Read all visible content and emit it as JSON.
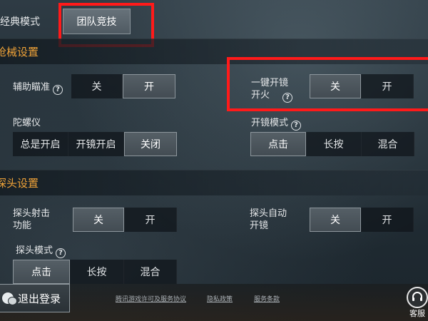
{
  "tabs": {
    "classic": "经典模式",
    "team": "团队竞技"
  },
  "weapon_section": {
    "title": "枪械设置",
    "assist_aim": {
      "label": "辅助瞄准",
      "options": [
        "关",
        "开"
      ],
      "selected": 1
    },
    "one_key_scope_fire": {
      "label_line1": "一键开镜",
      "label_line2": "开火",
      "options": [
        "关",
        "开"
      ],
      "selected": 0
    },
    "gyroscope": {
      "label": "陀螺仪",
      "options": [
        "总是开启",
        "开镜开启",
        "关闭"
      ],
      "selected": 2
    },
    "scope_mode": {
      "label": "开镜模式",
      "options": [
        "点击",
        "长按",
        "混合"
      ],
      "selected": 0
    }
  },
  "peek_section": {
    "title": "探头设置",
    "peek_fire": {
      "label_line1": "探头射击",
      "label_line2": "功能",
      "options": [
        "关",
        "开"
      ],
      "selected": 0
    },
    "peek_auto_scope": {
      "label_line1": "探头自动",
      "label_line2": "开镜",
      "options": [
        "关",
        "开"
      ],
      "selected": 0
    },
    "peek_mode": {
      "label": "探头模式",
      "options": [
        "点击",
        "长按",
        "混合"
      ],
      "selected": 0
    }
  },
  "footer": {
    "logout": "退出登录",
    "link1": "腾讯游戏许可及服务协议",
    "link2": "隐私政策",
    "link3": "服务条款",
    "service": "客服"
  },
  "colors": {
    "accent": "#f0a338",
    "highlight_box": "#ff1a1a"
  },
  "icons": {
    "help": "question-circle-icon",
    "logout": "wechat-icon",
    "service": "headset-icon"
  }
}
